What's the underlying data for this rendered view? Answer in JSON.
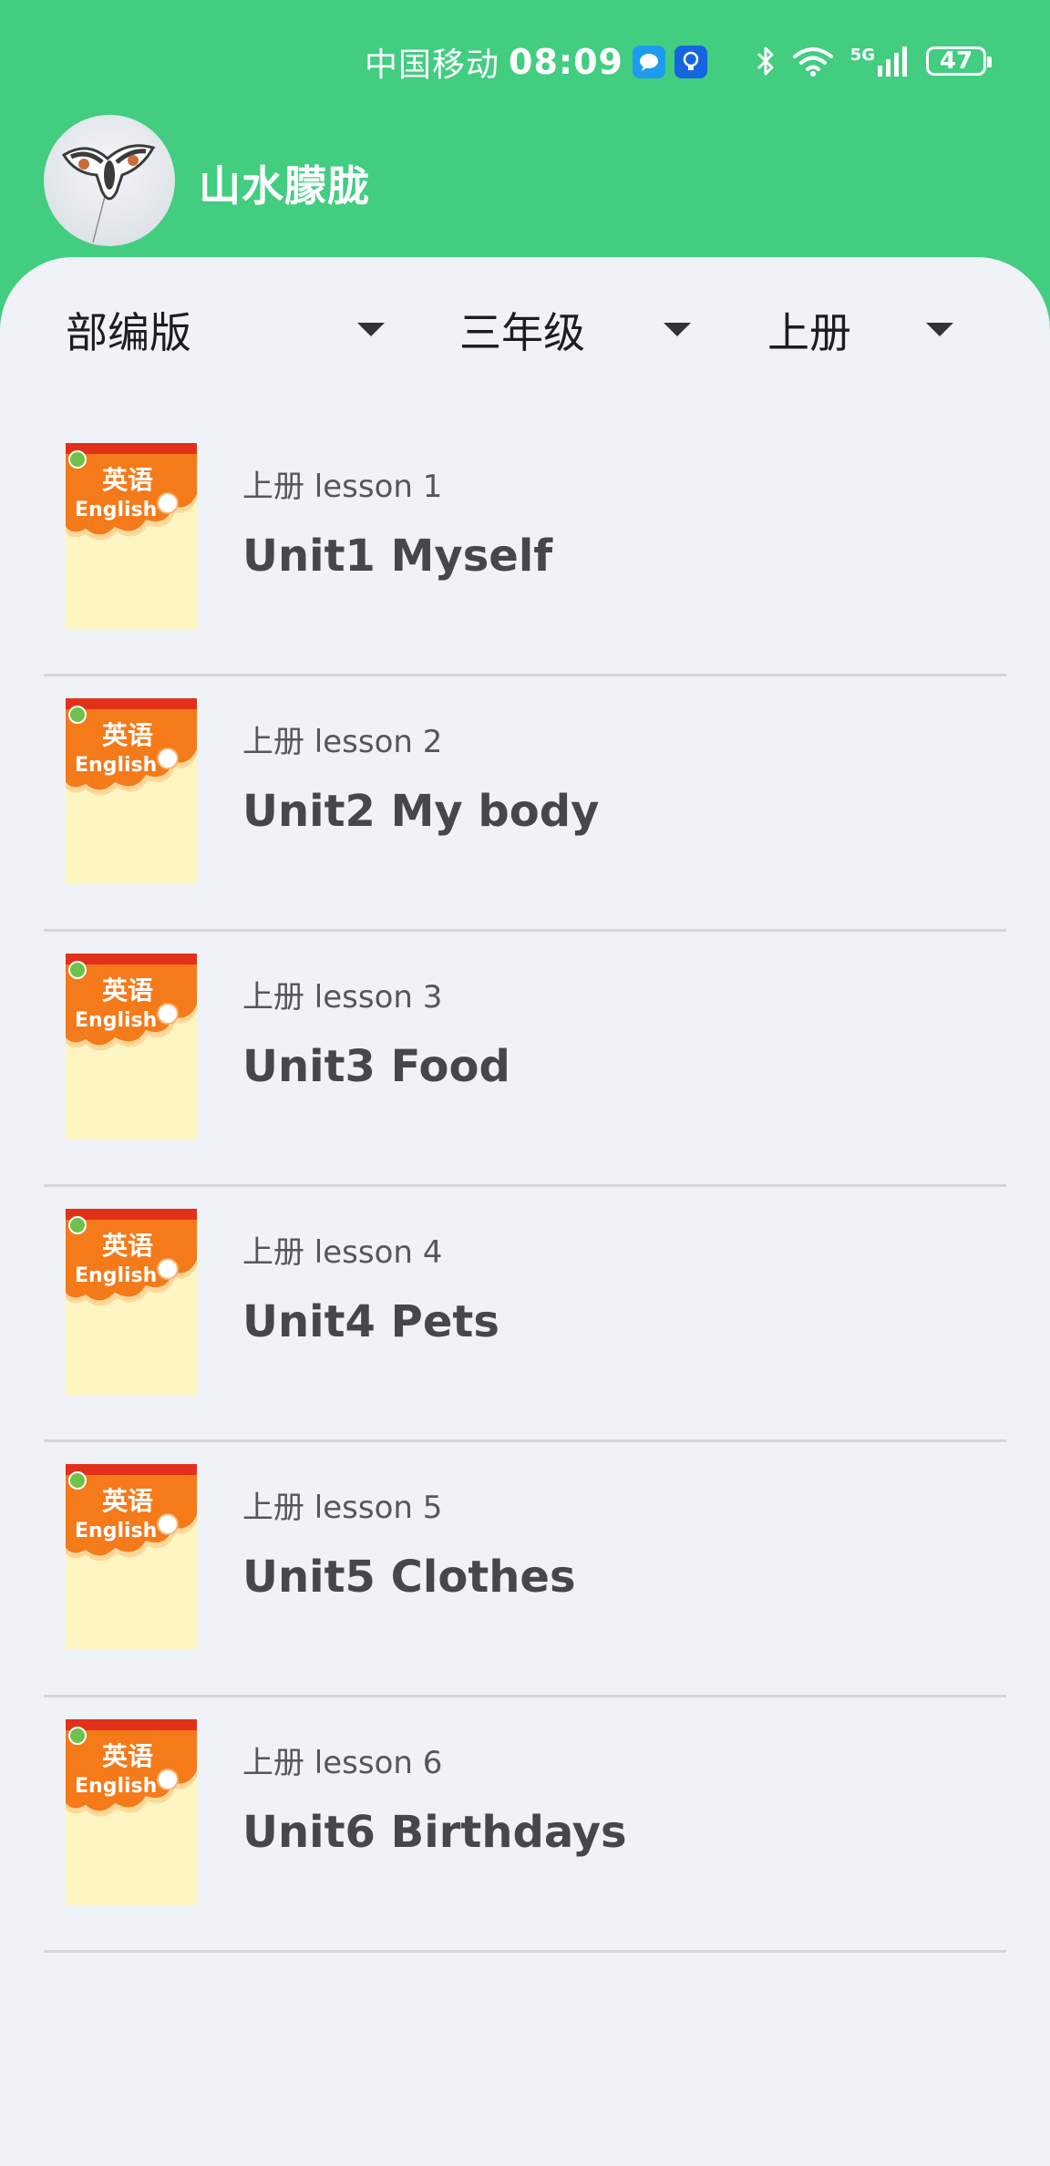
{
  "status_bar": {
    "carrier": "中国移动",
    "time": "08:09",
    "network": "5G",
    "battery": "47"
  },
  "header": {
    "username": "山水朦胧"
  },
  "filters": {
    "edition": "部编版",
    "grade": "三年级",
    "volume": "上册"
  },
  "cover": {
    "title_cn": "英语",
    "title_en": "English"
  },
  "lessons": [
    {
      "subtitle": "上册 lesson 1",
      "title": "Unit1 Myself"
    },
    {
      "subtitle": "上册 lesson 2",
      "title": "Unit2 My body"
    },
    {
      "subtitle": "上册 lesson 3",
      "title": "Unit3 Food"
    },
    {
      "subtitle": "上册 lesson 4",
      "title": "Unit4 Pets"
    },
    {
      "subtitle": "上册 lesson 5",
      "title": "Unit5 Clothes"
    },
    {
      "subtitle": "上册 lesson 6",
      "title": "Unit6 Birthdays"
    }
  ],
  "colors": {
    "brand": "#42cd81",
    "sheet_bg": "#eff2f7",
    "cover_orange": "#f47a1a",
    "cover_cream": "#fdf6c2"
  }
}
